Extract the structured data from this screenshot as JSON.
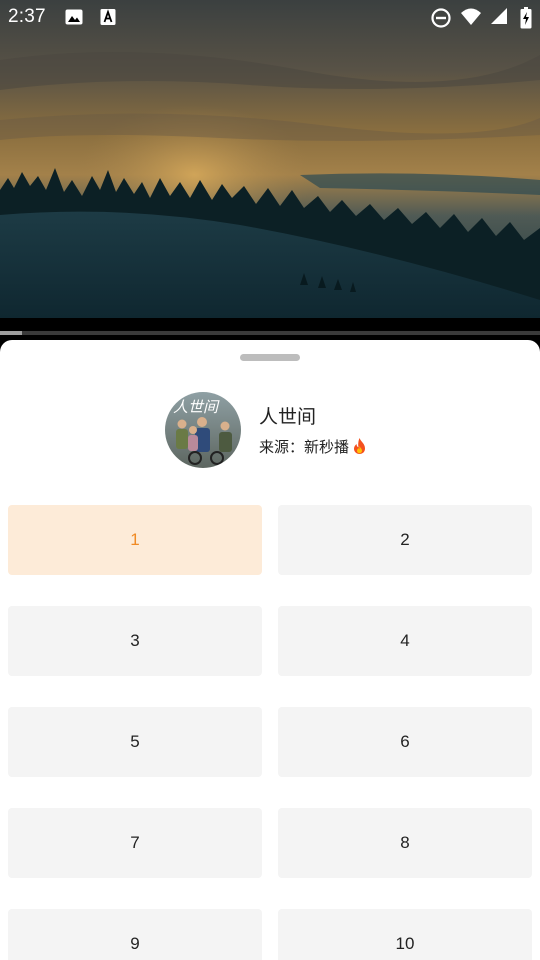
{
  "status_bar": {
    "time": "2:37",
    "left_icons": [
      "image-icon",
      "text-a-icon"
    ],
    "right_icons": [
      "do-not-disturb-icon",
      "wifi-icon",
      "cellular-signal-icon",
      "battery-charging-icon"
    ]
  },
  "player": {
    "scene": "snowy hillside with pine trees at sunset",
    "progress_fraction": 0.04
  },
  "drama": {
    "title": "人世间",
    "source_label": "来源：",
    "source_name": "新秒播",
    "source_icon": "fire-icon",
    "poster_text": "人世间"
  },
  "episodes": {
    "selected": "1",
    "items": [
      "1",
      "2",
      "3",
      "4",
      "5",
      "6",
      "7",
      "8",
      "9",
      "10"
    ]
  },
  "colors": {
    "selected_bg": "#fdebd8",
    "selected_text": "#f08a24",
    "tile_bg": "#f4f4f4",
    "sheet_bg": "#ffffff"
  }
}
